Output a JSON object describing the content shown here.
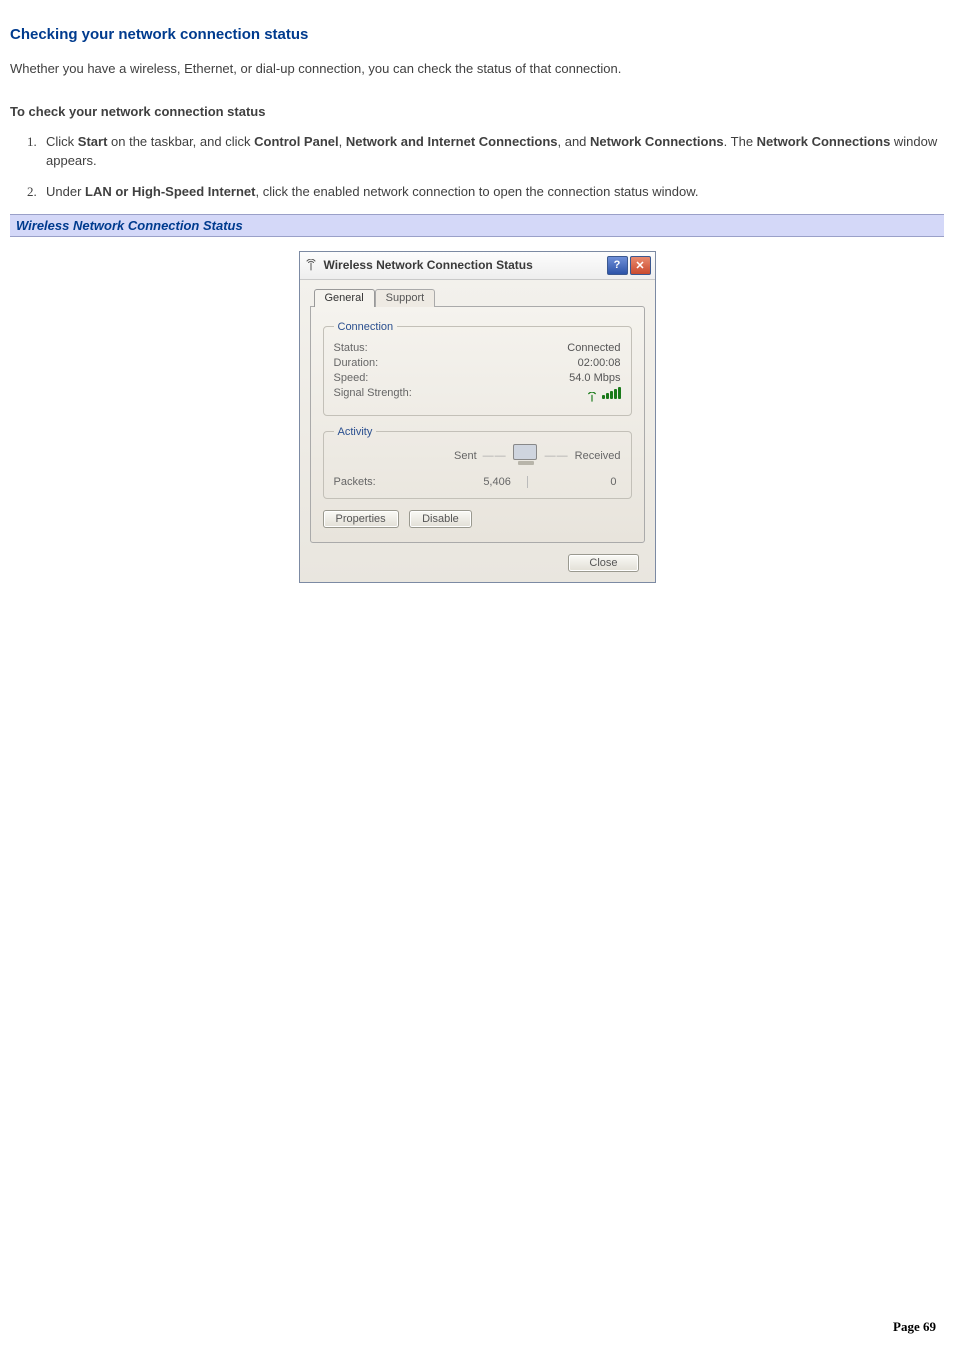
{
  "heading": "Checking your network connection status",
  "intro": "Whether you have a wireless, Ethernet, or dial-up connection, you can check the status of that connection.",
  "subhead": "To check your network connection status",
  "steps": {
    "1": {
      "pre": "Click ",
      "b1": "Start",
      "t1": " on the taskbar, and click ",
      "b2": "Control Panel",
      "t2": ", ",
      "b3": "Network and Internet Connections",
      "t3": ", and ",
      "b4": "Network Connections",
      "t4": ". The ",
      "b5": "Network Connections",
      "t5": " window appears."
    },
    "2": {
      "pre": "Under ",
      "b1": "LAN or High-Speed Internet",
      "t1": ", click the enabled network connection to open the connection status window."
    }
  },
  "caption": "Wireless Network Connection Status",
  "dialog": {
    "title": "Wireless Network Connection Status",
    "tabs": {
      "general": "General",
      "support": "Support"
    },
    "group_connection": "Connection",
    "status_label": "Status:",
    "status_value": "Connected",
    "duration_label": "Duration:",
    "duration_value": "02:00:08",
    "speed_label": "Speed:",
    "speed_value": "54.0 Mbps",
    "signal_label": "Signal Strength:",
    "group_activity": "Activity",
    "sent_label": "Sent",
    "received_label": "Received",
    "packets_label": "Packets:",
    "packets_sent": "5,406",
    "packets_received": "0",
    "btn_properties": "Properties",
    "btn_disable": "Disable",
    "btn_close": "Close"
  },
  "footer": {
    "label": "Page ",
    "num": "69"
  }
}
